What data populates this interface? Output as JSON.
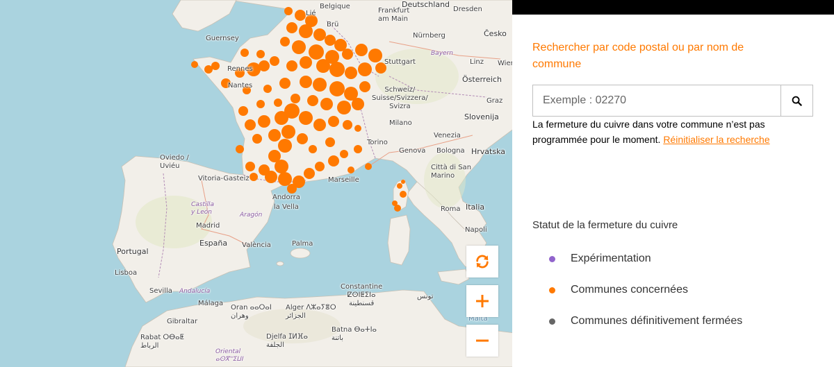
{
  "map": {
    "labels": {
      "deutschland": "Deutschland",
      "belgique": "Belgique",
      "frankfurt": "Frankfurt\nam Main",
      "dresden": "Dresden",
      "nurnberg": "Nürnberg",
      "cesko": "Česko",
      "bayern": "Bayern",
      "stuttgart": "Stuttgart",
      "linz": "Linz",
      "wien": "Wien",
      "osterreich": "Österreich",
      "guernsey": "Guernsey",
      "rennes": "Rennes",
      "nantes": "Nantes",
      "schweiz": "Schweiz/\nSuisse/Svizzera/\nSvizra",
      "graz": "Graz",
      "slovenija": "Slovenija",
      "milano": "Milano",
      "venezia": "Venezia",
      "torino": "Torino",
      "genova": "Genova",
      "bologna": "Bologna",
      "hrvatska": "Hrvatska",
      "oviedo": "Oviedo /\nUviéu",
      "vitoria": "Vitoria-Gasteiz",
      "andorra": "Andorra\nla Vella",
      "marseille": "Marseille",
      "citta_san_marino": "Città di San\nMarino",
      "castilla": "Castilla\ny León",
      "aragon": "Aragón",
      "roma": "Roma",
      "italia": "Italia",
      "madrid": "Madrid",
      "espana": "España",
      "portugal": "Portugal",
      "valencia": "València",
      "palma": "Palma",
      "napoli": "Napoli",
      "lisboa": "Lisboa",
      "sevilla": "Sevilla",
      "andalucia": "Andalucía",
      "malaga": "Málaga",
      "oran": "Oran ⴰⴰⵔⴰⵏ\nوهران",
      "alger": "Alger ⴷⵣⴰⵢⴻⵔ\nالجزائر",
      "constantine": "Constantine\nⵇⵙⵏⵟⵉⵏⴰ\nقسنطينة",
      "gibraltar": "Gibraltar",
      "rabat": "Rabat ⵔⴱⴰⵟ\nالرباط",
      "djelfa": "Djelfa ⵊⵍⴼⴰ\nالجلفة",
      "batna": "Batna ⴱⴰⵜⵏⴰ\nباتنة",
      "oriental": "Oriental\nⴰⵙⴳⵯⵉⵡⵏ",
      "tunis": "تونس",
      "malta": "Malta",
      "liege": "Lié",
      "brussels": "Brü"
    }
  },
  "controls": {
    "refresh_icon": "refresh-icon",
    "zoom_in_icon": "plus-icon",
    "zoom_out_icon": "minus-icon"
  },
  "panel": {
    "search_title": "Rechercher par code postal ou par nom de commune",
    "search_placeholder": "Exemple : 02270",
    "search_icon": "search-icon",
    "message": "La fermeture du cuivre dans votre commune n’est pas programmée pour le moment.",
    "reset_link": "Réinitialiser la recherche",
    "legend_title": "Statut de la fermeture du cuivre",
    "legend": [
      {
        "label": "Expérimentation",
        "color": "#9164cc"
      },
      {
        "label": "Communes concernées",
        "color": "#ff7900"
      },
      {
        "label": "Communes définitivement fermées",
        "color": "#666666"
      }
    ]
  },
  "colors": {
    "accent": "#ff7900",
    "sea": "#aad3df",
    "land": "#f2efe9"
  }
}
